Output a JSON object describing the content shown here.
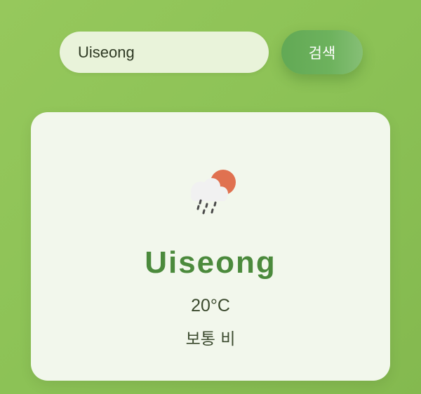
{
  "search": {
    "value": "Uiseong",
    "button_label": "검색"
  },
  "weather": {
    "icon": "cloud-sun-rain-icon",
    "city": "Uiseong",
    "temperature": "20°C",
    "description": "보통 비"
  },
  "colors": {
    "background": "#8cc256",
    "button": "#62a955",
    "card": "#f2f7ec",
    "city_text": "#4b8a3c",
    "sun": "#e07150"
  }
}
